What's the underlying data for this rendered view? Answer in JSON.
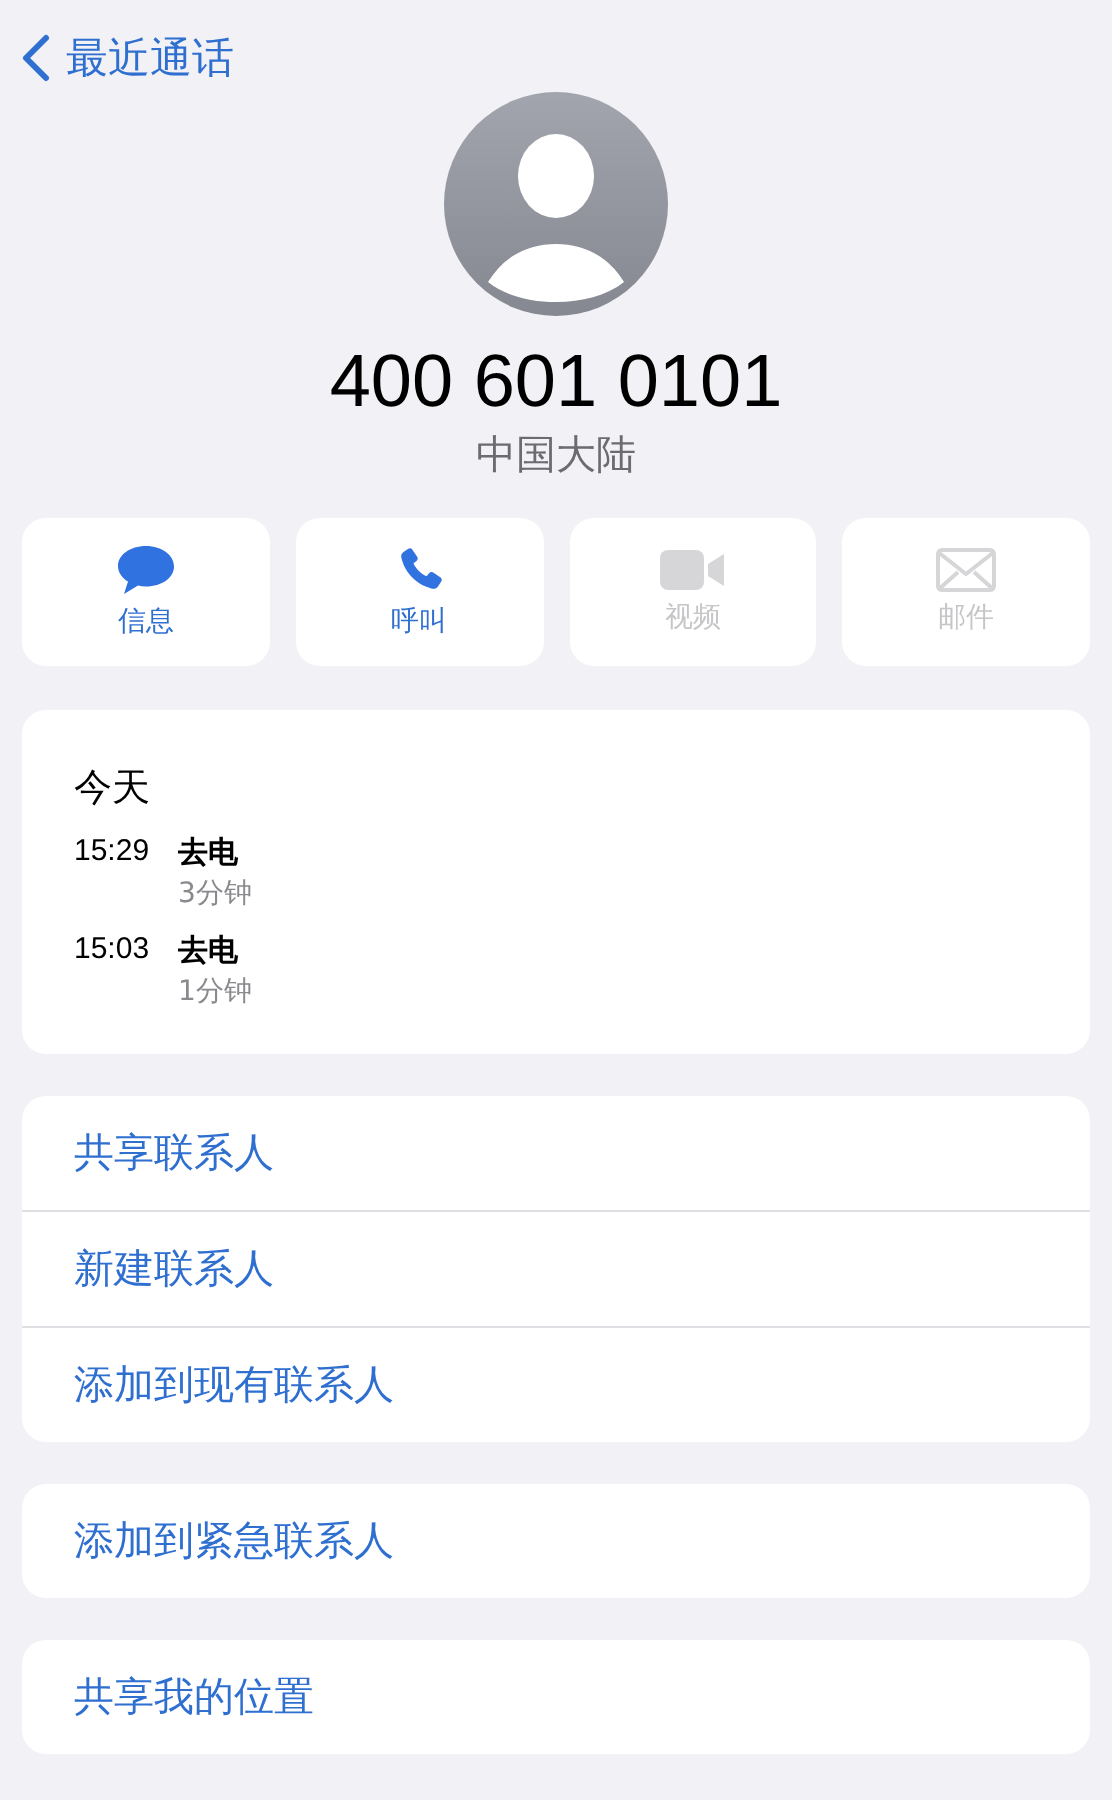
{
  "nav": {
    "back_label": "最近通话"
  },
  "contact": {
    "number": "400 601 0101",
    "region": "中国大陆"
  },
  "actions": [
    {
      "kind": "message",
      "label": "信息",
      "disabled": false
    },
    {
      "kind": "call",
      "label": "呼叫",
      "disabled": false
    },
    {
      "kind": "video",
      "label": "视频",
      "disabled": true
    },
    {
      "kind": "mail",
      "label": "邮件",
      "disabled": true
    }
  ],
  "call_history": {
    "heading": "今天",
    "calls": [
      {
        "time": "15:29",
        "type": "去电",
        "duration": "3分钟"
      },
      {
        "time": "15:03",
        "type": "去电",
        "duration": "1分钟"
      }
    ]
  },
  "option_groups": [
    [
      "共享联系人",
      "新建联系人",
      "添加到现有联系人"
    ],
    [
      "添加到紧急联系人"
    ],
    [
      "共享我的位置"
    ]
  ]
}
